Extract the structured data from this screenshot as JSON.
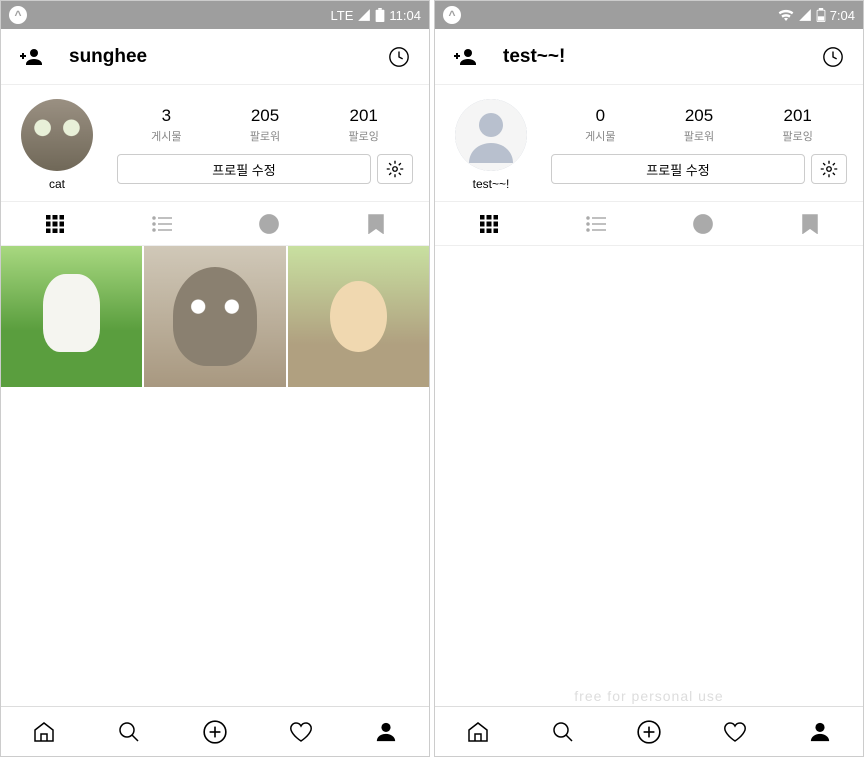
{
  "left": {
    "status": {
      "network": "LTE",
      "time": "11:04"
    },
    "username": "sunghee",
    "avatar_name": "cat",
    "stats": {
      "posts": {
        "num": "3",
        "label": "게시물"
      },
      "followers": {
        "num": "205",
        "label": "팔로워"
      },
      "following": {
        "num": "201",
        "label": "팔로잉"
      }
    },
    "edit_label": "프로필 수정"
  },
  "right": {
    "status": {
      "time": "7:04"
    },
    "username": "test~~!",
    "avatar_name": "test~~!",
    "stats": {
      "posts": {
        "num": "0",
        "label": "게시물"
      },
      "followers": {
        "num": "205",
        "label": "팔로워"
      },
      "following": {
        "num": "201",
        "label": "팔로잉"
      }
    },
    "edit_label": "프로필 수정",
    "watermark": "free for personal use"
  }
}
